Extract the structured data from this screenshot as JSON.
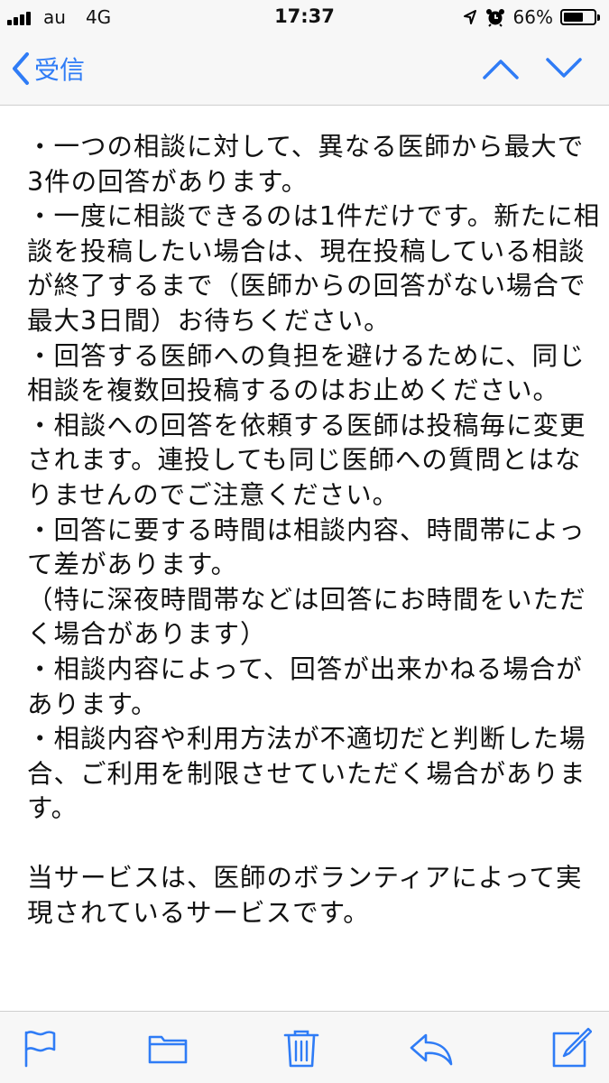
{
  "status_bar": {
    "carrier": "au",
    "network": "4G",
    "time": "17:37",
    "battery_percent": "66%",
    "battery_level": 0.66,
    "icons": [
      "signal-icon",
      "location-arrow-icon",
      "alarm-clock-icon",
      "battery-icon"
    ]
  },
  "nav": {
    "back_label": "受信",
    "icons": [
      "chevron-left-icon",
      "chevron-up-icon",
      "chevron-down-icon"
    ]
  },
  "message": {
    "lines": [
      "・一つの相談に対して、異なる医師から最大で",
      "3件の回答があります。",
      "・一度に相談できるのは1件だけです。新たに相",
      "談を投稿したい場合は、現在投稿している相談",
      "が終了するまで（医師からの回答がない場合で",
      "最大3日間）お待ちください。",
      "・回答する医師への負担を避けるために、同じ",
      "相談を複数回投稿するのはお止めください。",
      "・相談への回答を依頼する医師は投稿毎に変更",
      "されます。連投しても同じ医師への質問とはな",
      "りませんのでご注意ください。",
      "・回答に要する時間は相談内容、時間帯によっ",
      "て差があります。",
      "（特に深夜時間帯などは回答にお時間をいただ",
      "く場合があります）",
      "・相談内容によって、回答が出来かねる場合が",
      "あります。",
      "・相談内容や利用方法が不適切だと判断した場",
      "合、ご利用を制限させていただく場合がありま",
      "す。",
      "",
      "当サービスは、医師のボランティアによって実",
      "現されているサービスです。"
    ]
  },
  "toolbar": {
    "icons": [
      "flag-icon",
      "folder-icon",
      "trash-icon",
      "reply-icon",
      "compose-icon"
    ]
  },
  "colors": {
    "accent": "#2f7cf6",
    "bar_background": "#f7f7f7",
    "text": "#111111"
  }
}
